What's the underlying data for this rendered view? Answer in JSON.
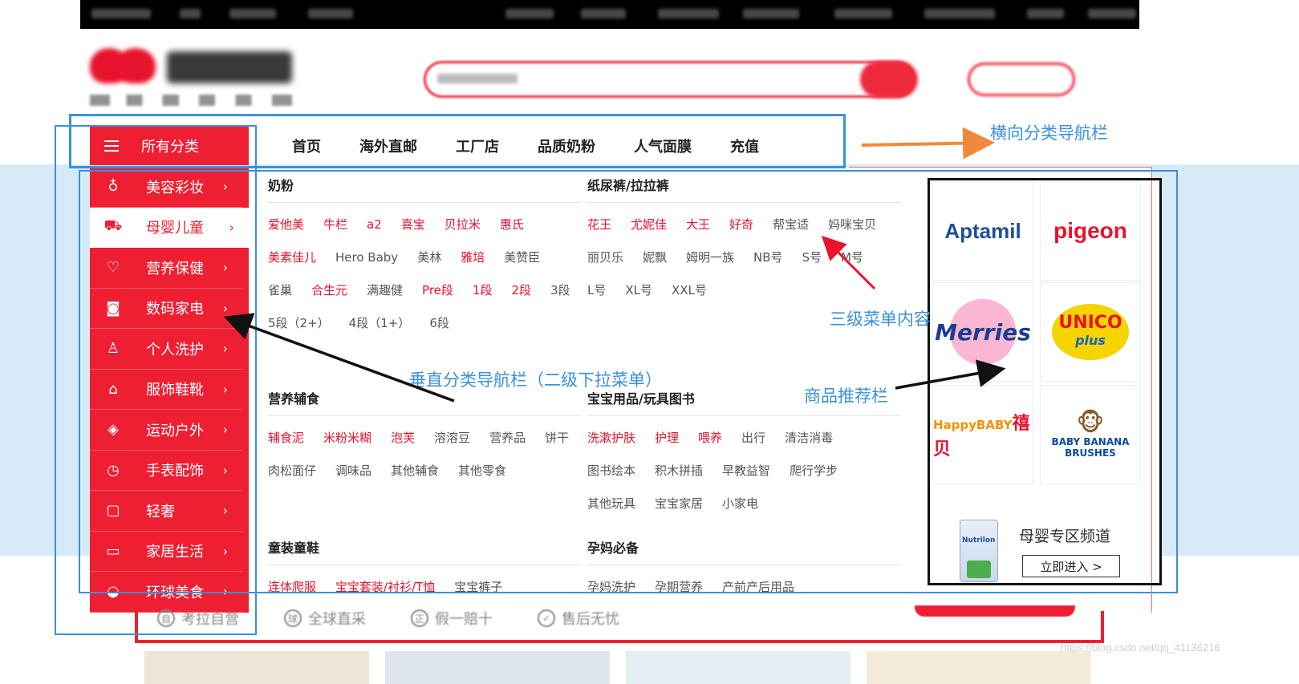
{
  "horizontal_nav": {
    "all_categories_label": "所有分类",
    "items": [
      "首页",
      "海外直邮",
      "工厂店",
      "品质奶粉",
      "人气面膜",
      "充值"
    ]
  },
  "vertical_menu": {
    "items": [
      {
        "label": "美容彩妆",
        "icon": "lipstick-icon",
        "active": false
      },
      {
        "label": "母婴儿童",
        "icon": "stroller-icon",
        "active": true
      },
      {
        "label": "营养保健",
        "icon": "heart-icon",
        "active": false
      },
      {
        "label": "数码家电",
        "icon": "camera-icon",
        "active": false
      },
      {
        "label": "个人洗护",
        "icon": "bottle-icon",
        "active": false
      },
      {
        "label": "服饰鞋靴",
        "icon": "hanger-icon",
        "active": false
      },
      {
        "label": "运动户外",
        "icon": "compass-icon",
        "active": false
      },
      {
        "label": "手表配饰",
        "icon": "clock-icon",
        "active": false
      },
      {
        "label": "轻奢",
        "icon": "bag-icon",
        "active": false
      },
      {
        "label": "家居生活",
        "icon": "sofa-icon",
        "active": false
      },
      {
        "label": "环球美食",
        "icon": "food-icon",
        "active": false
      }
    ]
  },
  "dropdown": {
    "categories": [
      {
        "title": "奶粉",
        "links": [
          {
            "t": "爱他美",
            "hot": true
          },
          {
            "t": "牛栏",
            "hot": true
          },
          {
            "t": "a2",
            "hot": true
          },
          {
            "t": "喜宝",
            "hot": true
          },
          {
            "t": "贝拉米",
            "hot": true
          },
          {
            "t": "惠氏",
            "hot": true
          },
          {
            "t": "美素佳儿",
            "hot": true
          },
          {
            "t": "Hero Baby",
            "hot": false
          },
          {
            "t": "美林",
            "hot": false
          },
          {
            "t": "雅培",
            "hot": true
          },
          {
            "t": "美赞臣",
            "hot": false
          },
          {
            "t": "雀巢",
            "hot": false
          },
          {
            "t": "合生元",
            "hot": true
          },
          {
            "t": "满趣健",
            "hot": false
          },
          {
            "t": "Pre段",
            "hot": true
          },
          {
            "t": "1段",
            "hot": true
          },
          {
            "t": "2段",
            "hot": true
          },
          {
            "t": "3段",
            "hot": false
          },
          {
            "t": "5段（2+）",
            "hot": false
          },
          {
            "t": "4段（1+）",
            "hot": false
          },
          {
            "t": "6段",
            "hot": false
          }
        ]
      },
      {
        "title": "纸尿裤/拉拉裤",
        "links": [
          {
            "t": "花王",
            "hot": true
          },
          {
            "t": "尤妮佳",
            "hot": true
          },
          {
            "t": "大王",
            "hot": true
          },
          {
            "t": "好奇",
            "hot": true
          },
          {
            "t": "帮宝适",
            "hot": false
          },
          {
            "t": "妈咪宝贝",
            "hot": false
          },
          {
            "t": "丽贝乐",
            "hot": false
          },
          {
            "t": "妮飘",
            "hot": false
          },
          {
            "t": "姆明一族",
            "hot": false
          },
          {
            "t": "NB号",
            "hot": false
          },
          {
            "t": "S号",
            "hot": false
          },
          {
            "t": "M号",
            "hot": false
          },
          {
            "t": "L号",
            "hot": false
          },
          {
            "t": "XL号",
            "hot": false
          },
          {
            "t": "XXL号",
            "hot": false
          }
        ]
      },
      {
        "title": "营养辅食",
        "links": [
          {
            "t": "辅食泥",
            "hot": true
          },
          {
            "t": "米粉米糊",
            "hot": true
          },
          {
            "t": "泡芙",
            "hot": true
          },
          {
            "t": "溶溶豆",
            "hot": false
          },
          {
            "t": "营养品",
            "hot": false
          },
          {
            "t": "饼干",
            "hot": false
          },
          {
            "t": "肉松面仔",
            "hot": false
          },
          {
            "t": "调味品",
            "hot": false
          },
          {
            "t": "其他辅食",
            "hot": false
          },
          {
            "t": "其他零食",
            "hot": false
          }
        ]
      },
      {
        "title": "宝宝用品/玩具图书",
        "links": [
          {
            "t": "洗漱护肤",
            "hot": true
          },
          {
            "t": "护理",
            "hot": true
          },
          {
            "t": "喂养",
            "hot": true
          },
          {
            "t": "出行",
            "hot": false
          },
          {
            "t": "清洁消毒",
            "hot": false
          },
          {
            "t": "图书绘本",
            "hot": false
          },
          {
            "t": "积木拼插",
            "hot": false
          },
          {
            "t": "早教益智",
            "hot": false
          },
          {
            "t": "爬行学步",
            "hot": false
          },
          {
            "t": "其他玩具",
            "hot": false
          },
          {
            "t": "宝宝家居",
            "hot": false
          },
          {
            "t": "小家电",
            "hot": false
          }
        ]
      },
      {
        "title": "童装童鞋",
        "links": [
          {
            "t": "连体爬服",
            "hot": true
          },
          {
            "t": "宝宝套装/衬衫/T恤",
            "hot": true
          },
          {
            "t": "宝宝裤子",
            "hot": false
          }
        ]
      },
      {
        "title": "孕妈必备",
        "links": [
          {
            "t": "孕妈洗护",
            "hot": false
          },
          {
            "t": "孕期营养",
            "hot": false
          },
          {
            "t": "产前产后用品",
            "hot": false
          }
        ]
      }
    ]
  },
  "brands": [
    "Aptamil",
    "Pigeon",
    "Merries",
    "UNICO plus",
    "HappyBABY禧贝",
    "BABY BANANA BRUSHES"
  ],
  "zone": {
    "title": "母婴专区频道",
    "enter_label": "立即进入 >",
    "can_label": "Nutrilon"
  },
  "bottom_services": [
    "考拉自营",
    "全球直采",
    "假一赔十",
    "售后无忧"
  ],
  "annotations": {
    "horizontal_nav": "横向分类导航栏",
    "third_level": "三级菜单内容",
    "vertical_nav": "垂直分类导航栏（二级下拉菜单）",
    "recommend": "商品推荐栏"
  },
  "watermark": "https://blog.csdn.net/qq_41136216",
  "colors": {
    "brand_red": "#ef1f33",
    "annotation_blue": "#3a90db",
    "band_blue": "#d6eaf8"
  }
}
